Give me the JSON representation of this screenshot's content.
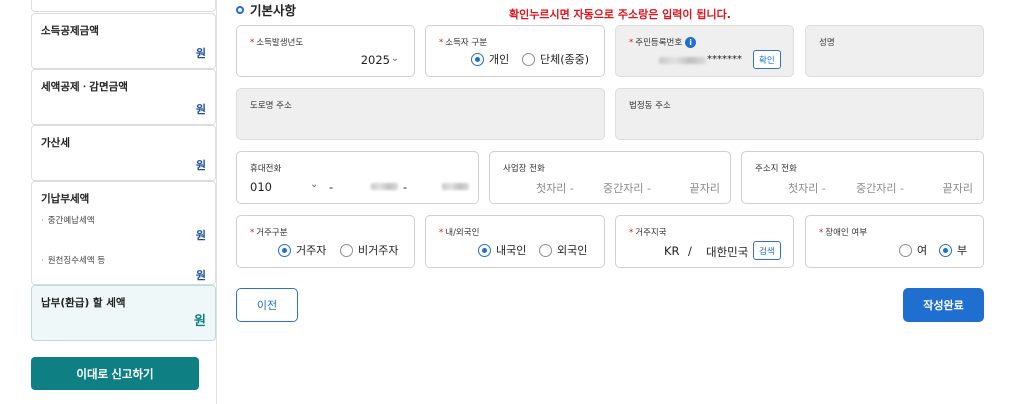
{
  "sidebar": {
    "items": [
      {
        "title": "",
        "unit": "원"
      },
      {
        "title": "소득공제금액",
        "unit": "원"
      },
      {
        "title": "세액공제ㆍ감면금액",
        "unit": "원"
      },
      {
        "title": "가산세",
        "unit": "원"
      },
      {
        "title": "기납부세액",
        "subitems": [
          {
            "label": "중간예납세액",
            "unit": "원"
          },
          {
            "label": "원천징수세액 등",
            "unit": "원"
          }
        ]
      },
      {
        "title": "납부(환급) 할 세액",
        "unit": "원"
      }
    ],
    "submit_label": "이대로 신고하기"
  },
  "section": {
    "title": "기본사항"
  },
  "annotation": "확인누르시면 자동으로 주소랑은 입력이 됩니다.",
  "form": {
    "year": {
      "label": "소득발생년도",
      "value": "2025"
    },
    "earner_type": {
      "label": "소득자 구분",
      "options": [
        "개인",
        "단체(종중)"
      ],
      "selected": "개인"
    },
    "rrn": {
      "label": "주민등록번호",
      "masked_suffix": "*******",
      "confirm_label": "확인"
    },
    "name": {
      "label": "성명"
    },
    "road_address": {
      "label": "도로명 주소"
    },
    "legal_address": {
      "label": "법정동 주소"
    },
    "mobile": {
      "label": "휴대전화",
      "prefix": "010",
      "dash": "-"
    },
    "work_phone": {
      "label": "사업장 전화",
      "placeholders": [
        "첫자리 -",
        "중간자리 -",
        "끝자리"
      ]
    },
    "home_phone": {
      "label": "주소지 전화",
      "placeholders": [
        "첫자리 -",
        "중간자리 -",
        "끝자리"
      ]
    },
    "residency": {
      "label": "거주구분",
      "options": [
        "거주자",
        "비거주자"
      ],
      "selected": "거주자"
    },
    "nationality": {
      "label": "내/외국인",
      "options": [
        "내국인",
        "외국인"
      ],
      "selected": "내국인"
    },
    "country": {
      "label": "거주지국",
      "code": "KR",
      "separator": "/",
      "name": "대한민국",
      "search_label": "검색"
    },
    "disability": {
      "label": "장애인 여부",
      "options": [
        "여",
        "부"
      ],
      "selected": "부"
    }
  },
  "buttons": {
    "prev": "이전",
    "done": "작성완료"
  },
  "colors": {
    "primary": "#1f6fd0",
    "teal": "#0e7f83",
    "required": "#e0161e",
    "annotation": "#e0161e"
  }
}
